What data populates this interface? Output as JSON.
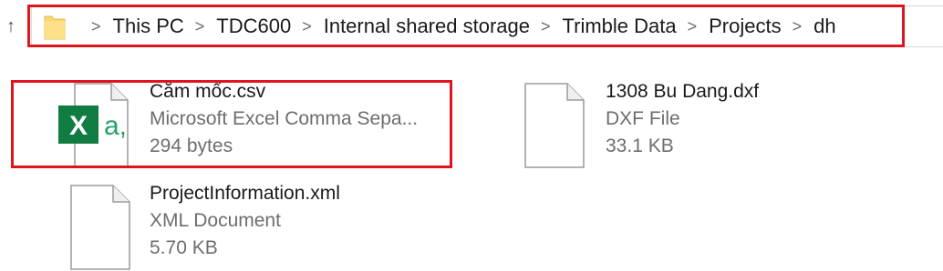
{
  "address_bar": {
    "crumbs": [
      "This PC",
      "TDC600",
      "Internal shared storage",
      "Trimble Data",
      "Projects",
      "dh"
    ],
    "separator": ">"
  },
  "files": [
    {
      "name": "Cắm mốc.csv",
      "type": "Microsoft Excel Comma Sepa...",
      "size": "294 bytes",
      "icon": "excel-csv-icon"
    },
    {
      "name": "1308 Bu Dang.dxf",
      "type": "DXF File",
      "size": "33.1 KB",
      "icon": "blank-file-icon"
    },
    {
      "name": "ProjectInformation.xml",
      "type": "XML Document",
      "size": "5.70 KB",
      "icon": "blank-file-icon"
    }
  ],
  "colors": {
    "highlight": "#e0141e",
    "excel_green": "#107c41",
    "excel_text": "#21a366"
  }
}
